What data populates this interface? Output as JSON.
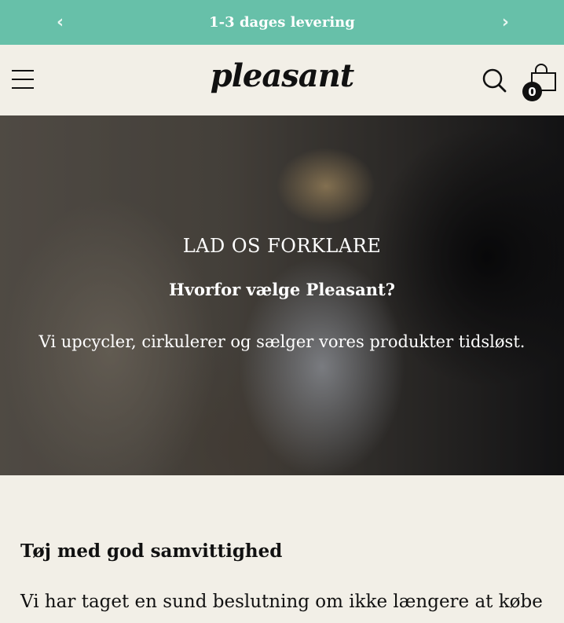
{
  "announcement": {
    "text": "1-3 dages levering",
    "prev_icon": "chevron-left-icon",
    "next_icon": "chevron-right-icon"
  },
  "header": {
    "logo": "pleasant",
    "cart_count": "0",
    "menu_icon": "hamburger-icon",
    "search_icon": "search-icon",
    "cart_icon": "shopping-bag-icon"
  },
  "hero": {
    "kicker": "LAD OS FORKLARE",
    "title": "Hvorfor vælge Pleasant?",
    "body": "Vi upcycler, cirkulerer og sælger vores produkter tidsløst."
  },
  "section": {
    "title": "Tøj med god samvittighed",
    "body": "Vi har taget en sund beslutning om ikke længere at købe"
  },
  "colors": {
    "announcement_bg": "#67c0a9",
    "page_bg": "#f2efe7",
    "text": "#111111"
  }
}
